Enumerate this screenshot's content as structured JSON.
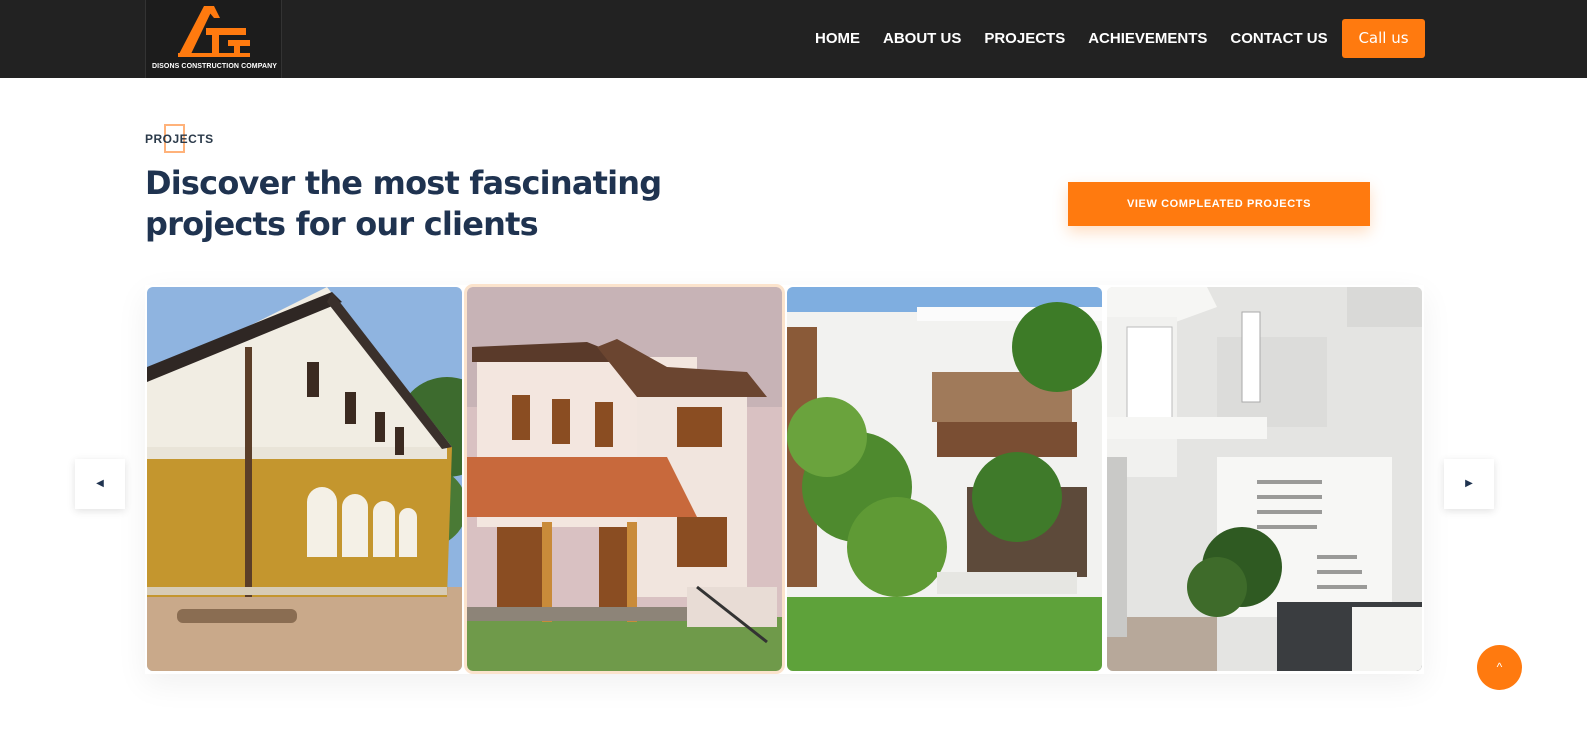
{
  "header": {
    "logo_caption": "DISONS CONSTRUCTION COMPANY",
    "nav": [
      "HOME",
      "ABOUT US",
      "PROJECTS",
      "ACHIEVEMENTS",
      "CONTACT US"
    ],
    "call_label": "Call us"
  },
  "section": {
    "eyebrow": "PROJECTS",
    "title": "Discover the most fascinating projects for our clients",
    "view_label": "VIEW COMPLEATED PROJECTS"
  },
  "carousel": {
    "prev_icon": "caret-left-icon",
    "next_icon": "caret-right-icon",
    "active_index": 1,
    "slides": [
      "project-photo-1",
      "project-photo-2",
      "project-photo-3",
      "project-photo-4"
    ]
  },
  "scroll_top_icon": "chevron-up-icon",
  "colors": {
    "accent": "#ff7a0f",
    "header_bg": "#222222",
    "heading": "#1f3350"
  }
}
